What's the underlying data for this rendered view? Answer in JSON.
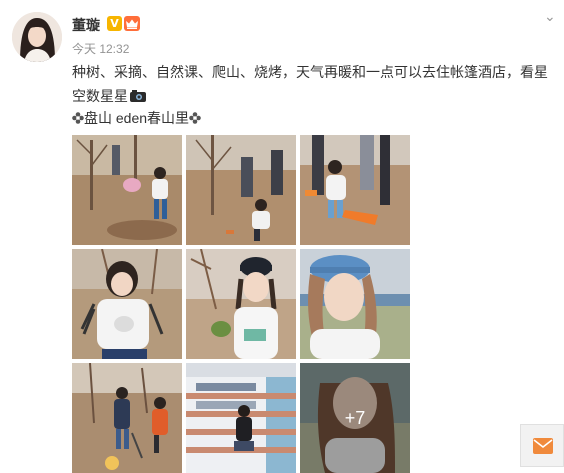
{
  "author": {
    "name": "董璇",
    "verified_badge": "V",
    "verified_color": "#f7b500",
    "crown_color": "#ff6e3a"
  },
  "post": {
    "time": "今天 12:32",
    "text": "种树、采摘、自然课、爬山、烧烤，天气再暖和一点可以去住帐篷酒店，看星空数星星",
    "location": "盘山 eden春山里"
  },
  "photos": {
    "more_count": "+7",
    "items": [
      {
        "name": "photo-1",
        "scene": "child-digging-orchard"
      },
      {
        "name": "photo-2",
        "scene": "planting-trees-group"
      },
      {
        "name": "photo-3",
        "scene": "child-with-orange-shovel"
      },
      {
        "name": "photo-4",
        "scene": "child-striped-shirt"
      },
      {
        "name": "photo-5",
        "scene": "child-navy-cap"
      },
      {
        "name": "photo-6",
        "scene": "child-blue-cap-closeup"
      },
      {
        "name": "photo-7",
        "scene": "adults-digging-hillside"
      },
      {
        "name": "photo-8",
        "scene": "woman-on-library-stairs"
      },
      {
        "name": "photo-9",
        "scene": "child-portrait-more"
      }
    ]
  },
  "icons": {
    "chevron": "chevron-down-icon",
    "camera": "camera-emoji-icon",
    "flower": "flower-icon",
    "message": "envelope-icon"
  }
}
